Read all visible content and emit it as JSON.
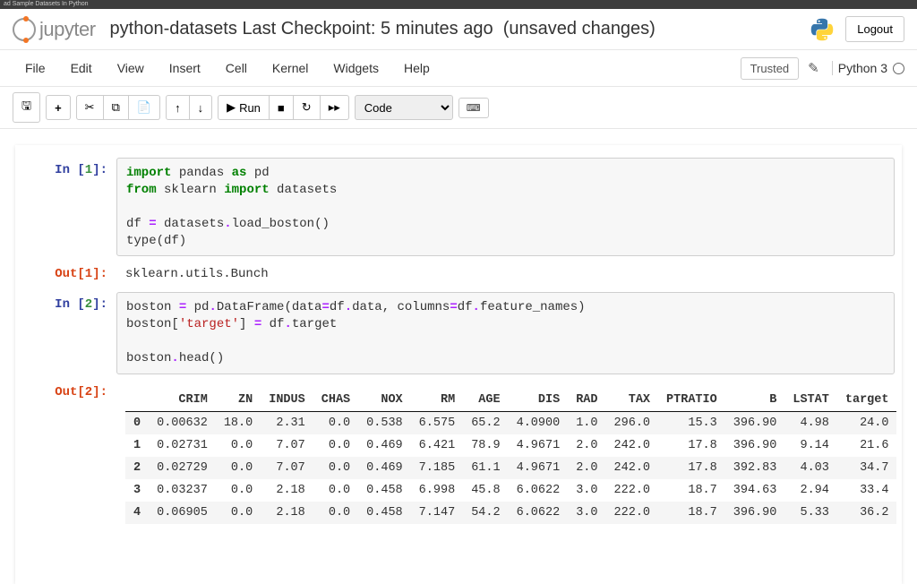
{
  "browserTab": "ad Sample Datasets In Python",
  "header": {
    "logoText": "jupyter",
    "notebookName": "python-datasets",
    "checkpoint": "Last Checkpoint: 5 minutes ago",
    "unsaved": "(unsaved changes)",
    "logout": "Logout"
  },
  "menubar": {
    "items": [
      "File",
      "Edit",
      "View",
      "Insert",
      "Cell",
      "Kernel",
      "Widgets",
      "Help"
    ],
    "trusted": "Trusted",
    "kernel": "Python 3"
  },
  "toolbar": {
    "runLabel": "Run",
    "cellType": "Code"
  },
  "cells": [
    {
      "inPrompt": "In [1]:",
      "code": {
        "l1a": "import",
        "l1b": " pandas ",
        "l1c": "as",
        "l1d": " pd",
        "l2a": "from",
        "l2b": " sklearn ",
        "l2c": "import",
        "l2d": " datasets",
        "l3": "",
        "l4a": "df ",
        "l4b": "=",
        "l4c": " datasets",
        "l4d": ".",
        "l4e": "load_boston()",
        "l5a": "type(df)"
      },
      "outPrompt": "Out[1]:",
      "outputText": "sklearn.utils.Bunch"
    },
    {
      "inPrompt": "In [2]:",
      "code": {
        "l1a": "boston ",
        "l1b": "=",
        "l1c": " pd",
        "l1d": ".",
        "l1e": "DataFrame(data",
        "l1f": "=",
        "l1g": "df",
        "l1h": ".",
        "l1i": "data, columns",
        "l1j": "=",
        "l1k": "df",
        "l1l": ".",
        "l1m": "feature_names)",
        "l2a": "boston[",
        "l2b": "'target'",
        "l2c": "] ",
        "l2d": "=",
        "l2e": " df",
        "l2f": ".",
        "l2g": "target",
        "l3": "",
        "l4a": "boston",
        "l4b": ".",
        "l4c": "head()"
      },
      "outPrompt": "Out[2]:"
    }
  ],
  "chart_data": {
    "type": "table",
    "columns": [
      "",
      "CRIM",
      "ZN",
      "INDUS",
      "CHAS",
      "NOX",
      "RM",
      "AGE",
      "DIS",
      "RAD",
      "TAX",
      "PTRATIO",
      "B",
      "LSTAT",
      "target"
    ],
    "index": [
      "0",
      "1",
      "2",
      "3",
      "4"
    ],
    "rows": [
      [
        "0.00632",
        "18.0",
        "2.31",
        "0.0",
        "0.538",
        "6.575",
        "65.2",
        "4.0900",
        "1.0",
        "296.0",
        "15.3",
        "396.90",
        "4.98",
        "24.0"
      ],
      [
        "0.02731",
        "0.0",
        "7.07",
        "0.0",
        "0.469",
        "6.421",
        "78.9",
        "4.9671",
        "2.0",
        "242.0",
        "17.8",
        "396.90",
        "9.14",
        "21.6"
      ],
      [
        "0.02729",
        "0.0",
        "7.07",
        "0.0",
        "0.469",
        "7.185",
        "61.1",
        "4.9671",
        "2.0",
        "242.0",
        "17.8",
        "392.83",
        "4.03",
        "34.7"
      ],
      [
        "0.03237",
        "0.0",
        "2.18",
        "0.0",
        "0.458",
        "6.998",
        "45.8",
        "6.0622",
        "3.0",
        "222.0",
        "18.7",
        "394.63",
        "2.94",
        "33.4"
      ],
      [
        "0.06905",
        "0.0",
        "2.18",
        "0.0",
        "0.458",
        "7.147",
        "54.2",
        "6.0622",
        "3.0",
        "222.0",
        "18.7",
        "396.90",
        "5.33",
        "36.2"
      ]
    ]
  }
}
